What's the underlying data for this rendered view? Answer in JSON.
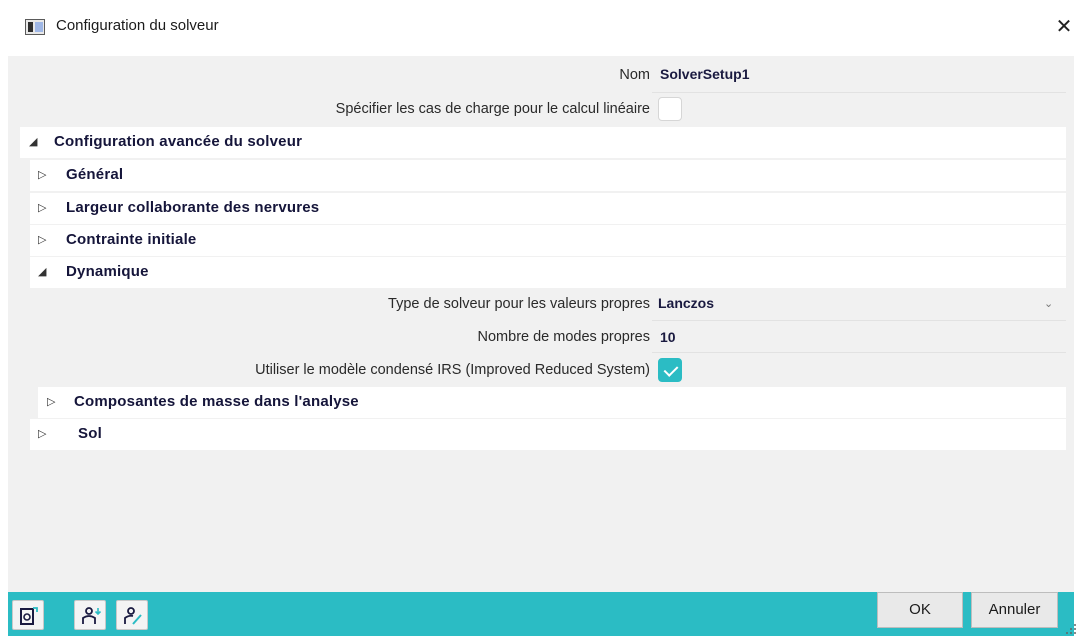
{
  "window": {
    "title": "Configuration du solveur",
    "close_label": "✕"
  },
  "fields": {
    "name_label": "Nom",
    "name_value": "SolverSetup1",
    "load_cases_label": "Spécifier les cas de charge pour le calcul linéaire",
    "load_cases_checked": false
  },
  "sections": {
    "advanced": "Configuration avancée du solveur",
    "general": "Général",
    "ribs": "Largeur collaborante des nervures",
    "initial_stress": "Contrainte initiale",
    "dynamics": "Dynamique",
    "mass": "Composantes de masse dans l'analyse",
    "soil": "Sol"
  },
  "dynamics": {
    "solver_type_label": "Type de solveur pour les valeurs propres",
    "solver_type_value": "Lanczos",
    "modes_label": "Nombre de modes propres",
    "modes_value": "10",
    "irs_label": "Utiliser le modèle condensé IRS (Improved Reduced System)",
    "irs_checked": true
  },
  "buttons": {
    "ok": "OK",
    "cancel": "Annuler"
  },
  "colors": {
    "accent": "#2bbcc4",
    "panel": "#f1f1f1"
  }
}
